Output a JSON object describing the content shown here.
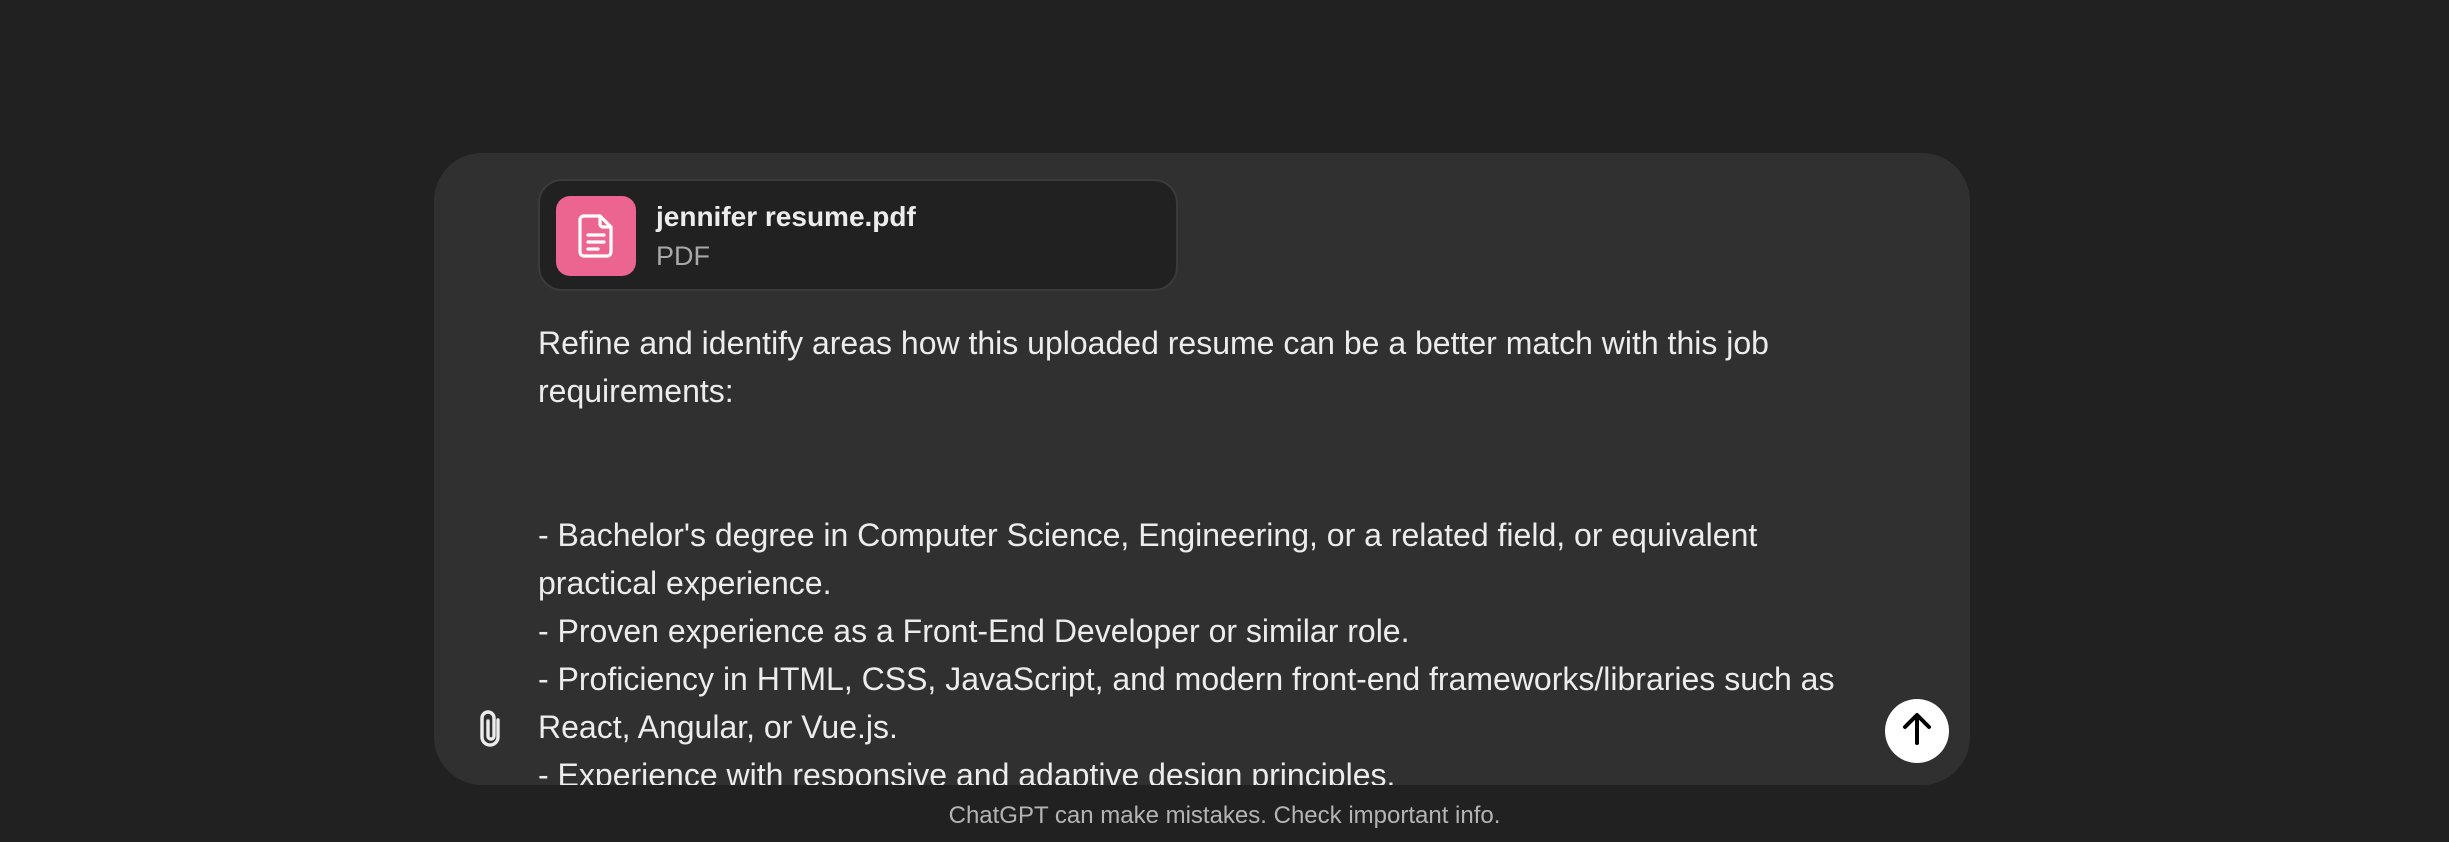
{
  "attachment": {
    "filename": "jennifer resume.pdf",
    "filetype": "PDF",
    "icon": "document-icon",
    "icon_color": "#ec6591"
  },
  "message": {
    "intro": "Refine and identify areas how this uploaded resume can be a better match with this job requirements:",
    "requirements": [
      "- Bachelor's degree in Computer Science, Engineering, or a related field, or equivalent practical experience.",
      "- Proven experience as a Front-End Developer or similar role.",
      "- Proficiency in HTML, CSS, JavaScript, and modern front-end frameworks/libraries such as React, Angular, or Vue.js.",
      "- Experience with responsive and adaptive design principles."
    ]
  },
  "composer": {
    "attach_icon": "paperclip-icon",
    "send_icon": "arrow-up-icon"
  },
  "footer": {
    "disclaimer": "ChatGPT can make mistakes. Check important info."
  },
  "colors": {
    "background": "#212121",
    "composer_bg": "#303030",
    "send_button": "#ffffff"
  }
}
